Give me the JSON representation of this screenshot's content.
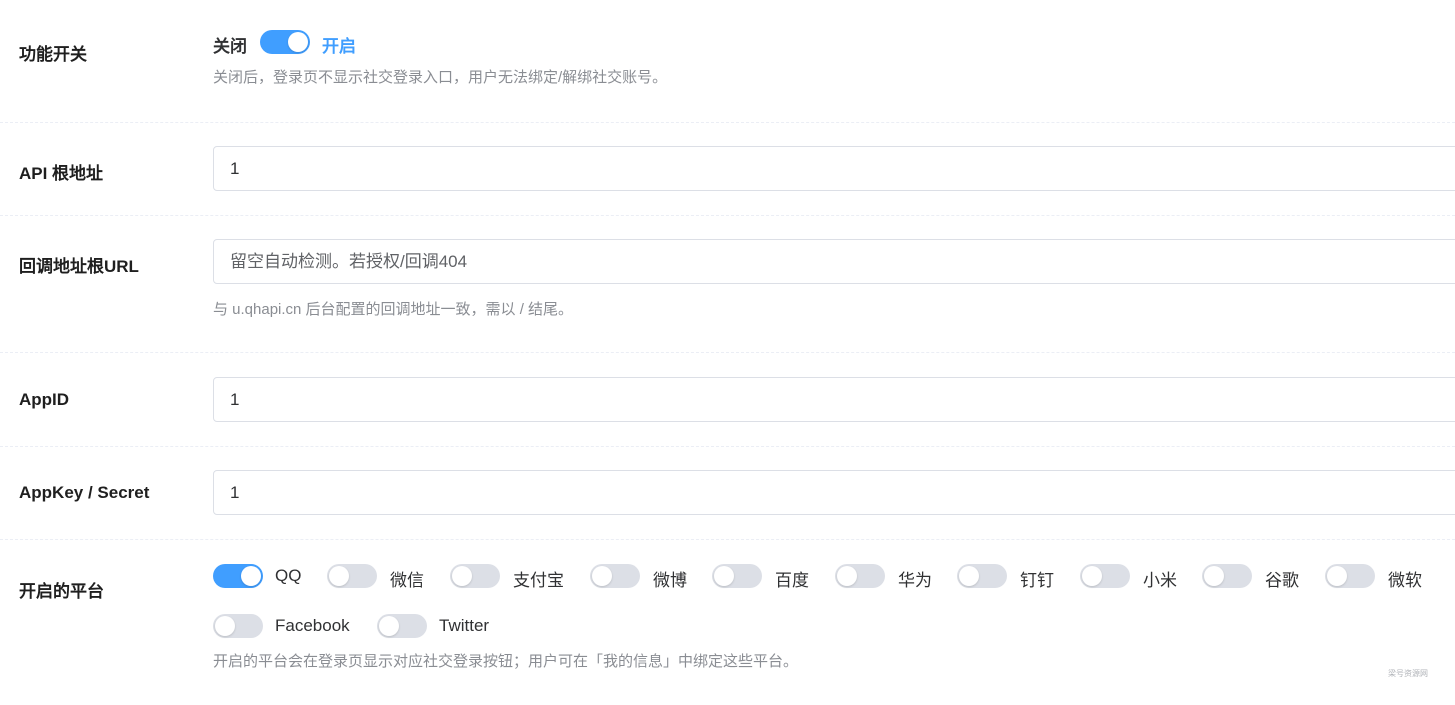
{
  "feature_switch": {
    "label": "功能开关",
    "off_text": "关闭",
    "on_text": "开启",
    "enabled": true,
    "hint": "关闭后，登录页不显示社交登录入口，用户无法绑定/解绑社交账号。"
  },
  "api_root": {
    "label": "API 根地址",
    "value": "1"
  },
  "callback_url": {
    "label": "回调地址根URL",
    "placeholder": "留空自动检测。若授权/回调404",
    "hint": "与 u.qhapi.cn 后台配置的回调地址一致，需以 / 结尾。"
  },
  "app_id": {
    "label": "AppID",
    "value": "1"
  },
  "app_key": {
    "label": "AppKey / Secret",
    "value": "1"
  },
  "platforms": {
    "label": "开启的平台",
    "items": [
      {
        "name": "QQ",
        "enabled": true
      },
      {
        "name": "微信",
        "enabled": false
      },
      {
        "name": "支付宝",
        "enabled": false
      },
      {
        "name": "微博",
        "enabled": false
      },
      {
        "name": "百度",
        "enabled": false
      },
      {
        "name": "华为",
        "enabled": false
      },
      {
        "name": "钉钉",
        "enabled": false
      },
      {
        "name": "小米",
        "enabled": false
      },
      {
        "name": "谷歌",
        "enabled": false
      },
      {
        "name": "微软",
        "enabled": false
      },
      {
        "name": "Facebook",
        "enabled": false
      },
      {
        "name": "Twitter",
        "enabled": false
      }
    ],
    "hint": "开启的平台会在登录页显示对应社交登录按钮；用户可在「我的信息」中绑定这些平台。"
  },
  "watermark": "梁号资源网",
  "colors": {
    "accent": "#409eff",
    "switch_off": "#dcdfe6"
  }
}
